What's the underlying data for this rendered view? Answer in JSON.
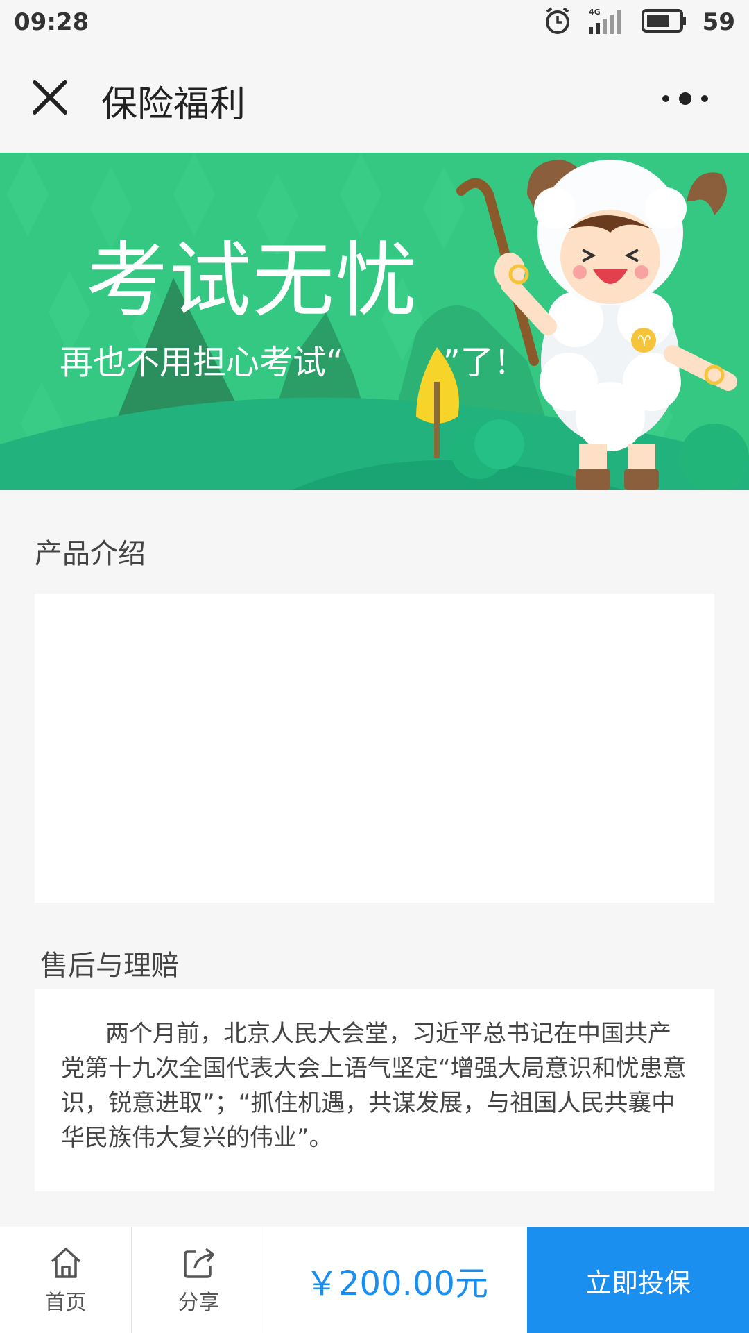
{
  "status_bar": {
    "time": "09:28",
    "network": "4G",
    "battery": "59"
  },
  "nav": {
    "title": "保险福利"
  },
  "banner": {
    "title": "考试无忧",
    "subtitle": "再也不用担心考试“　　　”了！"
  },
  "sections": {
    "product_intro": "产品介绍",
    "after_sales": "售后与理赔",
    "after_sales_text": "两个月前，北京人民大会堂，习近平总书记在中国共产党第十九次全国代表大会上语气坚定“增强大局意识和忧患意识，锐意进取”；“抓住机遇，共谋发展，与祖国人民共襄中华民族伟大复兴的伟业”。"
  },
  "bottom_bar": {
    "home_label": "首页",
    "share_label": "分享",
    "price": "￥200.00元",
    "buy_label": "立即投保"
  },
  "colors": {
    "banner_green": "#34c883",
    "accent_blue": "#1b8ff0"
  }
}
